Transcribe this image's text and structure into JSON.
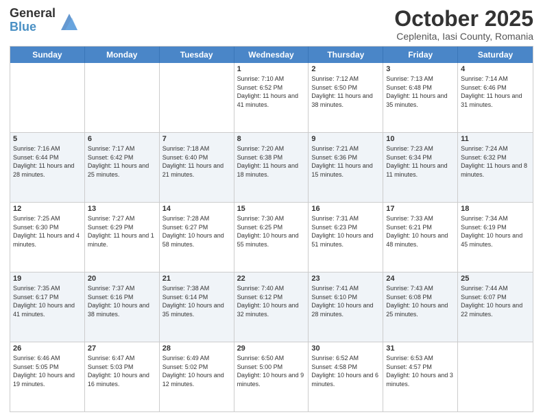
{
  "header": {
    "logo_general": "General",
    "logo_blue": "Blue",
    "month": "October 2025",
    "location": "Ceplenita, Iasi County, Romania"
  },
  "weekdays": [
    "Sunday",
    "Monday",
    "Tuesday",
    "Wednesday",
    "Thursday",
    "Friday",
    "Saturday"
  ],
  "rows": [
    {
      "alt": false,
      "cells": [
        {
          "day": "",
          "info": ""
        },
        {
          "day": "",
          "info": ""
        },
        {
          "day": "",
          "info": ""
        },
        {
          "day": "1",
          "info": "Sunrise: 7:10 AM\nSunset: 6:52 PM\nDaylight: 11 hours and 41 minutes."
        },
        {
          "day": "2",
          "info": "Sunrise: 7:12 AM\nSunset: 6:50 PM\nDaylight: 11 hours and 38 minutes."
        },
        {
          "day": "3",
          "info": "Sunrise: 7:13 AM\nSunset: 6:48 PM\nDaylight: 11 hours and 35 minutes."
        },
        {
          "day": "4",
          "info": "Sunrise: 7:14 AM\nSunset: 6:46 PM\nDaylight: 11 hours and 31 minutes."
        }
      ]
    },
    {
      "alt": true,
      "cells": [
        {
          "day": "5",
          "info": "Sunrise: 7:16 AM\nSunset: 6:44 PM\nDaylight: 11 hours and 28 minutes."
        },
        {
          "day": "6",
          "info": "Sunrise: 7:17 AM\nSunset: 6:42 PM\nDaylight: 11 hours and 25 minutes."
        },
        {
          "day": "7",
          "info": "Sunrise: 7:18 AM\nSunset: 6:40 PM\nDaylight: 11 hours and 21 minutes."
        },
        {
          "day": "8",
          "info": "Sunrise: 7:20 AM\nSunset: 6:38 PM\nDaylight: 11 hours and 18 minutes."
        },
        {
          "day": "9",
          "info": "Sunrise: 7:21 AM\nSunset: 6:36 PM\nDaylight: 11 hours and 15 minutes."
        },
        {
          "day": "10",
          "info": "Sunrise: 7:23 AM\nSunset: 6:34 PM\nDaylight: 11 hours and 11 minutes."
        },
        {
          "day": "11",
          "info": "Sunrise: 7:24 AM\nSunset: 6:32 PM\nDaylight: 11 hours and 8 minutes."
        }
      ]
    },
    {
      "alt": false,
      "cells": [
        {
          "day": "12",
          "info": "Sunrise: 7:25 AM\nSunset: 6:30 PM\nDaylight: 11 hours and 4 minutes."
        },
        {
          "day": "13",
          "info": "Sunrise: 7:27 AM\nSunset: 6:29 PM\nDaylight: 11 hours and 1 minute."
        },
        {
          "day": "14",
          "info": "Sunrise: 7:28 AM\nSunset: 6:27 PM\nDaylight: 10 hours and 58 minutes."
        },
        {
          "day": "15",
          "info": "Sunrise: 7:30 AM\nSunset: 6:25 PM\nDaylight: 10 hours and 55 minutes."
        },
        {
          "day": "16",
          "info": "Sunrise: 7:31 AM\nSunset: 6:23 PM\nDaylight: 10 hours and 51 minutes."
        },
        {
          "day": "17",
          "info": "Sunrise: 7:33 AM\nSunset: 6:21 PM\nDaylight: 10 hours and 48 minutes."
        },
        {
          "day": "18",
          "info": "Sunrise: 7:34 AM\nSunset: 6:19 PM\nDaylight: 10 hours and 45 minutes."
        }
      ]
    },
    {
      "alt": true,
      "cells": [
        {
          "day": "19",
          "info": "Sunrise: 7:35 AM\nSunset: 6:17 PM\nDaylight: 10 hours and 41 minutes."
        },
        {
          "day": "20",
          "info": "Sunrise: 7:37 AM\nSunset: 6:16 PM\nDaylight: 10 hours and 38 minutes."
        },
        {
          "day": "21",
          "info": "Sunrise: 7:38 AM\nSunset: 6:14 PM\nDaylight: 10 hours and 35 minutes."
        },
        {
          "day": "22",
          "info": "Sunrise: 7:40 AM\nSunset: 6:12 PM\nDaylight: 10 hours and 32 minutes."
        },
        {
          "day": "23",
          "info": "Sunrise: 7:41 AM\nSunset: 6:10 PM\nDaylight: 10 hours and 28 minutes."
        },
        {
          "day": "24",
          "info": "Sunrise: 7:43 AM\nSunset: 6:08 PM\nDaylight: 10 hours and 25 minutes."
        },
        {
          "day": "25",
          "info": "Sunrise: 7:44 AM\nSunset: 6:07 PM\nDaylight: 10 hours and 22 minutes."
        }
      ]
    },
    {
      "alt": false,
      "cells": [
        {
          "day": "26",
          "info": "Sunrise: 6:46 AM\nSunset: 5:05 PM\nDaylight: 10 hours and 19 minutes."
        },
        {
          "day": "27",
          "info": "Sunrise: 6:47 AM\nSunset: 5:03 PM\nDaylight: 10 hours and 16 minutes."
        },
        {
          "day": "28",
          "info": "Sunrise: 6:49 AM\nSunset: 5:02 PM\nDaylight: 10 hours and 12 minutes."
        },
        {
          "day": "29",
          "info": "Sunrise: 6:50 AM\nSunset: 5:00 PM\nDaylight: 10 hours and 9 minutes."
        },
        {
          "day": "30",
          "info": "Sunrise: 6:52 AM\nSunset: 4:58 PM\nDaylight: 10 hours and 6 minutes."
        },
        {
          "day": "31",
          "info": "Sunrise: 6:53 AM\nSunset: 4:57 PM\nDaylight: 10 hours and 3 minutes."
        },
        {
          "day": "",
          "info": ""
        }
      ]
    }
  ]
}
